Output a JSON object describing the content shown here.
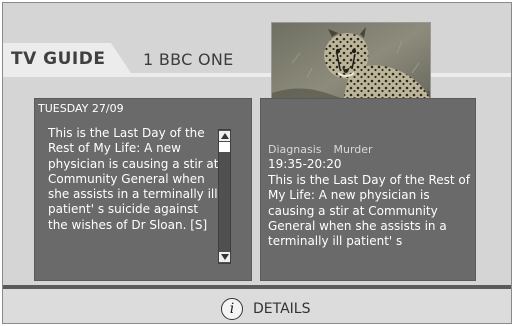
{
  "header": {
    "tab_label": "TV GUIDE",
    "channel": "1 BBC ONE"
  },
  "left_panel": {
    "date": "TUESDAY 27/09",
    "description": "This is the Last Day of the Rest of My Life: A new physician is causing a stir at Community General when she assists in a terminally ill patient' s suicide against the wishes of Dr Sloan. [S]"
  },
  "right_panel": {
    "title": "Diagnasis",
    "subtitle": "Murder",
    "time": "19:35-20:20",
    "description": "This is the Last Day of the Rest of My Life: A new physician is causing a stir at Community General when she assists in a terminally ill patient' s"
  },
  "footer": {
    "info_icon_glyph": "i",
    "details_label": "DETAILS"
  },
  "icons": [
    "info-icon",
    "scroll-up-arrow-icon",
    "scroll-down-arrow-icon"
  ],
  "colors": {
    "background": "#d5d5d5",
    "panel": "#6a6a6a",
    "tab": "#ececec",
    "text_on_panel": "#ffffff"
  }
}
